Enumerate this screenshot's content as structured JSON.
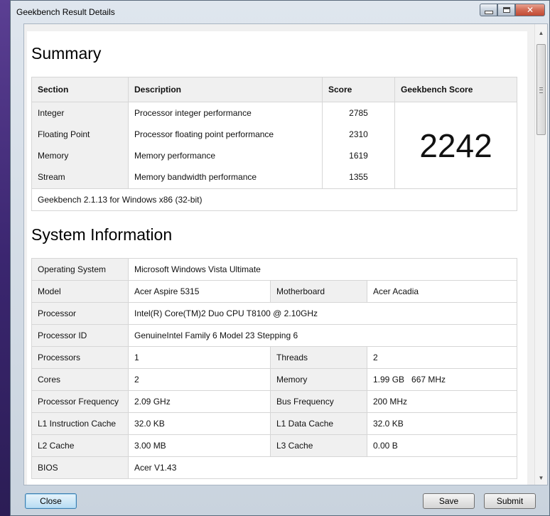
{
  "window": {
    "title": "Geekbench Result Details",
    "close_glyph": "✕"
  },
  "summary": {
    "heading": "Summary",
    "headers": [
      "Section",
      "Description",
      "Score",
      "Geekbench Score"
    ],
    "rows": [
      {
        "section": "Integer",
        "description": "Processor integer performance",
        "score": "2785"
      },
      {
        "section": "Floating Point",
        "description": "Processor floating point performance",
        "score": "2310"
      },
      {
        "section": "Memory",
        "description": "Memory performance",
        "score": "1619"
      },
      {
        "section": "Stream",
        "description": "Memory bandwidth performance",
        "score": "1355"
      }
    ],
    "geekbench_score": "2242",
    "version_note": "Geekbench 2.1.13 for Windows x86 (32-bit)"
  },
  "system": {
    "heading": "System Information",
    "os_label": "Operating System",
    "os": "Microsoft Windows Vista Ultimate",
    "model_label": "Model",
    "model": "Acer Aspire 5315",
    "motherboard_label": "Motherboard",
    "motherboard": "Acer Acadia",
    "processor_label": "Processor",
    "processor": "Intel(R) Core(TM)2 Duo CPU T8100 @ 2.10GHz",
    "processor_id_label": "Processor ID",
    "processor_id": "GenuineIntel Family 6 Model 23 Stepping 6",
    "processors_label": "Processors",
    "processors": "1",
    "threads_label": "Threads",
    "threads": "2",
    "cores_label": "Cores",
    "cores": "2",
    "memory_label": "Memory",
    "memory": "1.99 GB   667 MHz",
    "proc_freq_label": "Processor Frequency",
    "proc_freq": "2.09 GHz",
    "bus_freq_label": "Bus Frequency",
    "bus_freq": "200 MHz",
    "l1i_label": "L1 Instruction Cache",
    "l1i": "32.0 KB",
    "l1d_label": "L1 Data Cache",
    "l1d": "32.0 KB",
    "l2_label": "L2 Cache",
    "l2": "3.00 MB",
    "l3_label": "L3 Cache",
    "l3": "0.00 B",
    "bios_label": "BIOS",
    "bios": "Acer V1.43"
  },
  "buttons": {
    "close": "Close",
    "save": "Save",
    "submit": "Submit"
  },
  "scrollbar": {
    "up_glyph": "▲",
    "down_glyph": "▼"
  }
}
